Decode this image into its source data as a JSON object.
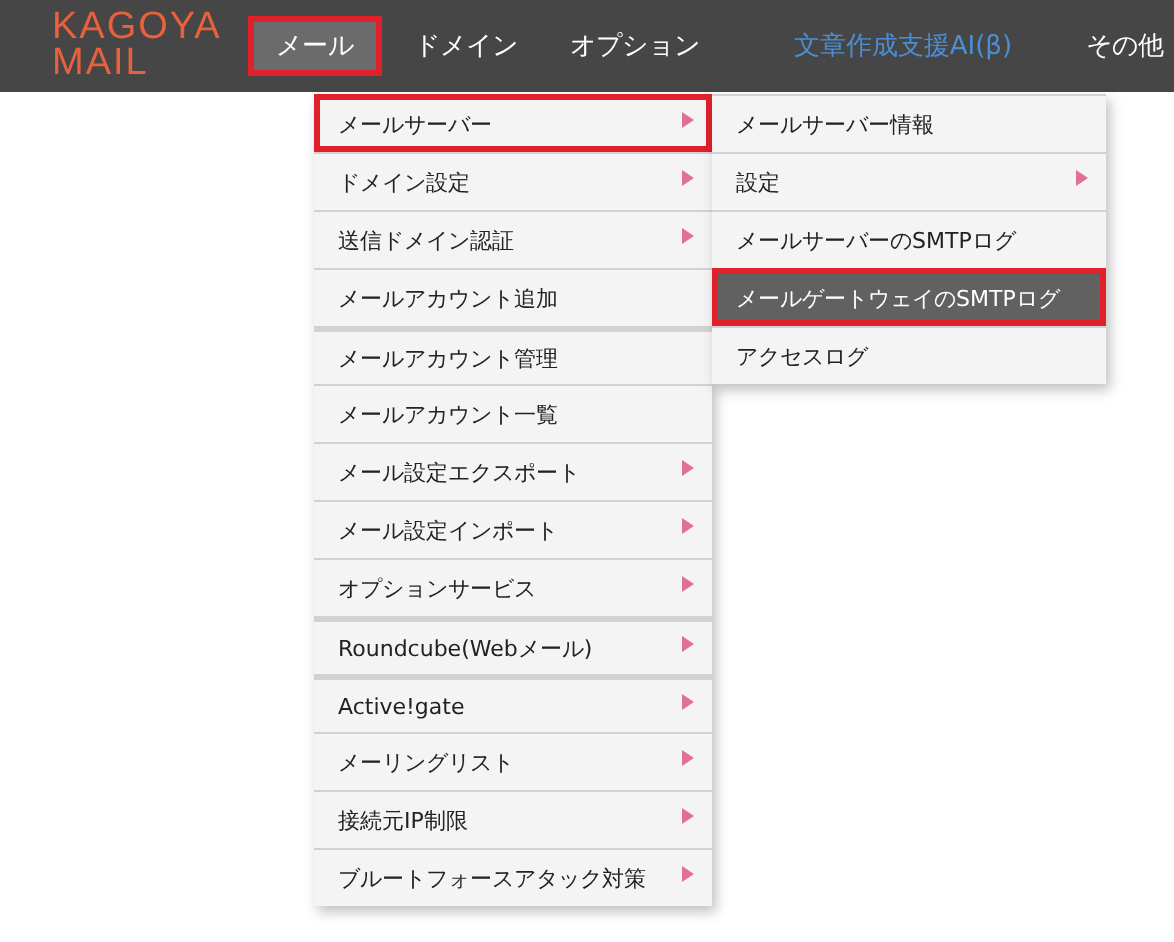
{
  "logo": {
    "line_1": "KAGOYA",
    "line_2": "MAIL"
  },
  "nav": [
    {
      "label": "メール",
      "selected": true,
      "outlined": true,
      "kind": "plain"
    },
    {
      "label": "ドメイン",
      "selected": false,
      "outlined": false,
      "kind": "plain"
    },
    {
      "label": "オプション",
      "selected": false,
      "outlined": false,
      "kind": "plain"
    },
    {
      "label": "文章作成支援AI(β)",
      "selected": false,
      "outlined": false,
      "kind": "accent"
    },
    {
      "label": "その他",
      "selected": false,
      "outlined": false,
      "kind": "plain"
    }
  ],
  "menu": [
    {
      "label": "メールサーバー",
      "outlined": true,
      "has_submenu": true,
      "separator_before": false
    },
    {
      "label": "ドメイン設定",
      "outlined": false,
      "has_submenu": true,
      "separator_before": false
    },
    {
      "label": "送信ドメイン認証",
      "outlined": false,
      "has_submenu": true,
      "separator_before": false
    },
    {
      "label": "メールアカウント追加",
      "outlined": false,
      "has_submenu": false,
      "separator_before": false
    },
    {
      "label": "メールアカウント管理",
      "outlined": false,
      "has_submenu": false,
      "separator_before": true
    },
    {
      "label": "メールアカウント一覧",
      "outlined": false,
      "has_submenu": false,
      "separator_before": false
    },
    {
      "label": "メール設定エクスポート",
      "outlined": false,
      "has_submenu": true,
      "separator_before": false
    },
    {
      "label": "メール設定インポート",
      "outlined": false,
      "has_submenu": true,
      "separator_before": false
    },
    {
      "label": "オプションサービス",
      "outlined": false,
      "has_submenu": true,
      "separator_before": false
    },
    {
      "label": "Roundcube(Webメール)",
      "outlined": false,
      "has_submenu": true,
      "separator_before": true
    },
    {
      "label": "Active!gate",
      "outlined": false,
      "has_submenu": true,
      "separator_before": true
    },
    {
      "label": "メーリングリスト",
      "outlined": false,
      "has_submenu": true,
      "separator_before": false
    },
    {
      "label": "接続元IP制限",
      "outlined": false,
      "has_submenu": true,
      "separator_before": false
    },
    {
      "label": "ブルートフォースアタック対策",
      "outlined": false,
      "has_submenu": true,
      "separator_before": false
    }
  ],
  "submenu": [
    {
      "label": "メールサーバー情報",
      "selected": false,
      "outlined": false,
      "has_submenu": false
    },
    {
      "label": "設定",
      "selected": false,
      "outlined": false,
      "has_submenu": true
    },
    {
      "label": "メールサーバーのSMTPログ",
      "selected": false,
      "outlined": false,
      "has_submenu": false
    },
    {
      "label": "メールゲートウェイのSMTPログ",
      "selected": true,
      "outlined": true,
      "has_submenu": false
    },
    {
      "label": "アクセスログ",
      "selected": false,
      "outlined": false,
      "has_submenu": false
    }
  ]
}
